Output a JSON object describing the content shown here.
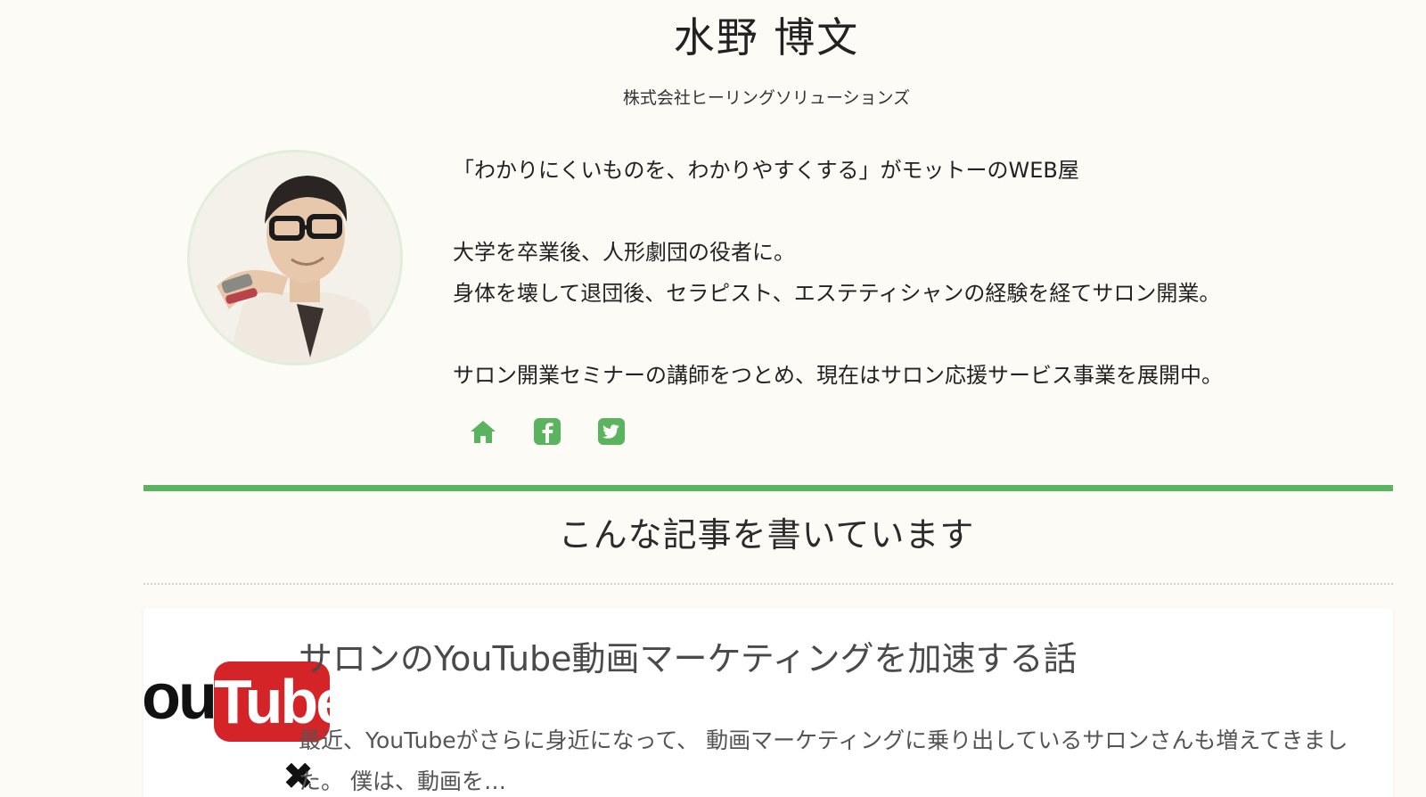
{
  "author": {
    "name": "水野 博文",
    "company": "株式会社ヒーリングソリューションズ",
    "bio": [
      "「わかりにくいものを、わかりやすくする」がモットーのWEB屋",
      "",
      "大学を卒業後、人形劇団の役者に。",
      "身体を壊して退団後、セラピスト、エステティシャンの経験を経てサロン開業。",
      "",
      "サロン開業セミナーの講師をつとめ、現在はサロン応援サービス事業を展開中。"
    ],
    "social_icons": [
      "home-icon",
      "facebook-icon",
      "twitter-icon"
    ]
  },
  "section": {
    "heading": "こんな記事を書いています"
  },
  "articles": [
    {
      "title": "サロンのYouTube動画マーケティングを加速する話",
      "excerpt": "最近、YouTubeがさらに身近になって、 動画マーケティングに乗り出しているサロンさんも増えてきました。 僕は、動画を…",
      "thumb_logo_text": "ou",
      "thumb_logo_box": "Tube",
      "thumb_cross": "✖"
    }
  ],
  "colors": {
    "accent": "#59b35f",
    "background": "#fdfbf6",
    "youtube_red": "#d42428"
  }
}
